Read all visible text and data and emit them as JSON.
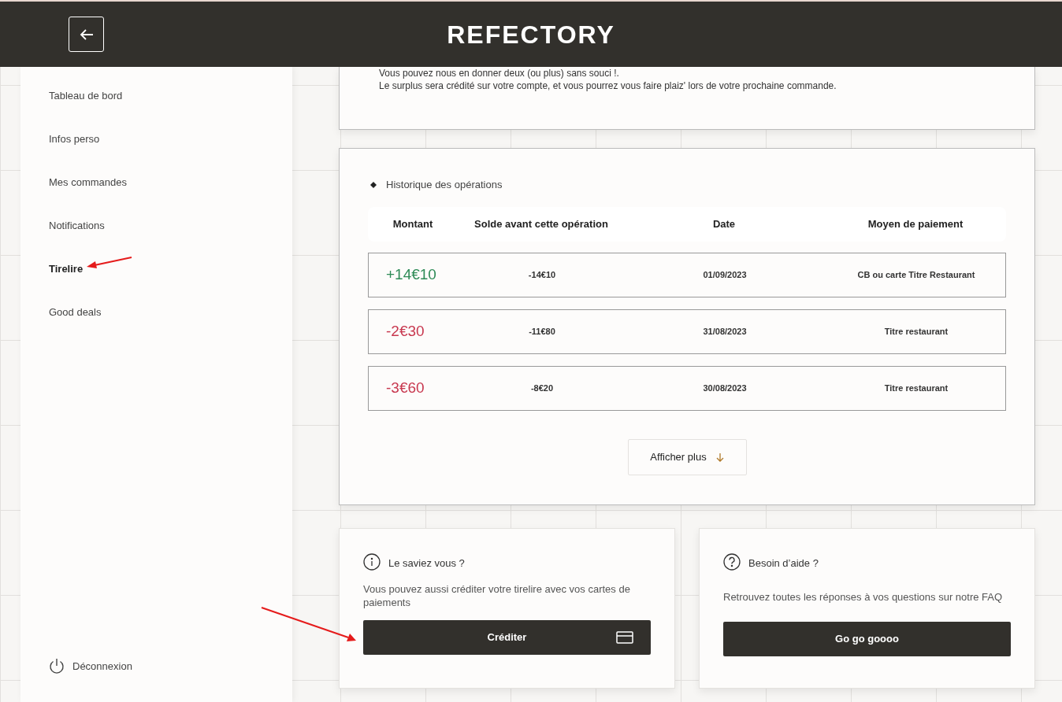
{
  "header": {
    "title": "REFECTORY"
  },
  "sidebar": {
    "items": [
      {
        "label": "Tableau de bord",
        "selected": false
      },
      {
        "label": "Infos perso",
        "selected": false
      },
      {
        "label": "Mes commandes",
        "selected": false
      },
      {
        "label": "Notifications",
        "selected": false
      },
      {
        "label": "Tirelire",
        "selected": true
      },
      {
        "label": "Good deals",
        "selected": false
      }
    ],
    "logout": "Déconnexion"
  },
  "info_card": {
    "lines": [
      "Vous pouvez nous en donner deux (ou plus) sans souci !.",
      "Le surplus sera crédité sur votre compte, et vous pourrez vous faire plaiz' lors de votre prochaine commande."
    ]
  },
  "history": {
    "title": "Historique des opérations",
    "columns": [
      "Montant",
      "Solde avant cette opération",
      "Date",
      "Moyen de paiement"
    ],
    "rows": [
      {
        "amount": "+14€10",
        "color": "#2e8b57",
        "balance": "-14€10",
        "date": "01/09/2023",
        "method": "CB ou carte Titre Restaurant"
      },
      {
        "amount": "-2€30",
        "color": "#c8384f",
        "balance": "-11€80",
        "date": "31/08/2023",
        "method": "Titre restaurant"
      },
      {
        "amount": "-3€60",
        "color": "#c8384f",
        "balance": "-8€20",
        "date": "30/08/2023",
        "method": "Titre restaurant"
      }
    ],
    "more_button": "Afficher plus"
  },
  "cards": [
    {
      "kind": "info",
      "title": "Le saviez vous ?",
      "text": "Vous pouvez aussi créditer votre tirelire avec vos cartes de paiements",
      "button": "Créditer"
    },
    {
      "kind": "help",
      "title": "Besoin d’aide ?",
      "text": "Retrouvez toutes les réponses à vos questions sur notre FAQ",
      "button": "Go go goooo"
    }
  ]
}
